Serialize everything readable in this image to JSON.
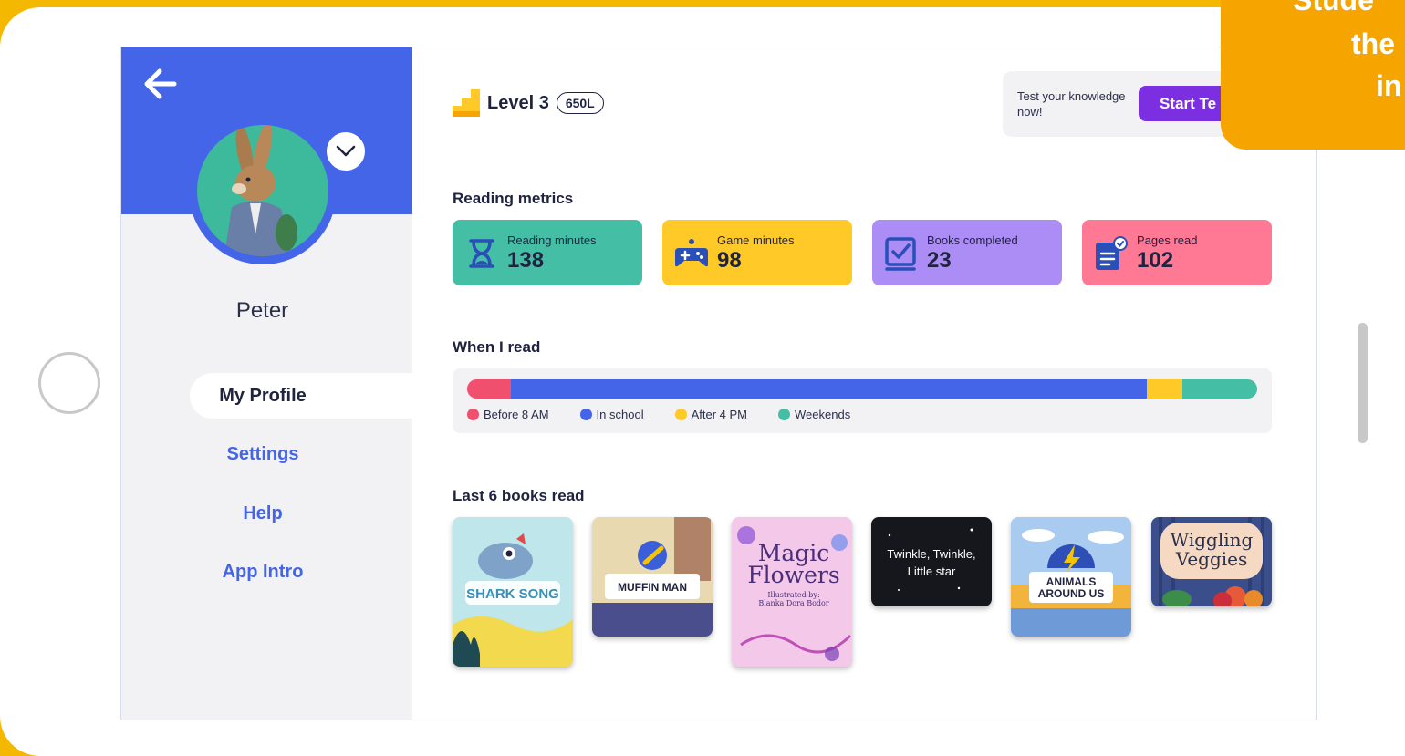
{
  "profile": {
    "name": "Peter"
  },
  "nav": [
    {
      "label": "My Profile",
      "active": true
    },
    {
      "label": "Settings",
      "active": false
    },
    {
      "label": "Help",
      "active": false
    },
    {
      "label": "App Intro",
      "active": false
    }
  ],
  "level": {
    "title": "Level 3",
    "lexile": "650L"
  },
  "test": {
    "prompt": "Test your knowledge now!",
    "button_label": "Start Te"
  },
  "overlay": {
    "line1": "Stude",
    "line2": "the",
    "line3": "in"
  },
  "metrics": {
    "section_title": "Reading metrics",
    "items": [
      {
        "label": "Reading minutes",
        "value": "138",
        "color": "#44BFA5",
        "icon": "hourglass-icon"
      },
      {
        "label": "Game minutes",
        "value": "98",
        "color": "#FFC928",
        "icon": "gamepad-icon"
      },
      {
        "label": "Books completed",
        "value": "23",
        "color": "#AC8CF5",
        "icon": "checkbox-icon"
      },
      {
        "label": "Pages read",
        "value": "102",
        "color": "#FF7894",
        "icon": "document-check-icon"
      }
    ]
  },
  "when_i_read": {
    "section_title": "When I read",
    "segments": [
      {
        "label": "Before 8 AM",
        "fraction": 0.056,
        "color": "#F0506E"
      },
      {
        "label": "In school",
        "fraction": 0.804,
        "color": "#4565E8"
      },
      {
        "label": "After 4 PM",
        "fraction": 0.045,
        "color": "#FFC928"
      },
      {
        "label": "Weekends",
        "fraction": 0.095,
        "color": "#44BFA5"
      }
    ]
  },
  "books": {
    "section_title": "Last 6 books read",
    "items": [
      {
        "title": "SHARK SONG"
      },
      {
        "title": "MUFFIN MAN"
      },
      {
        "title": "Magic Flowers",
        "byline": "Illustrated by: Blanka Dora Bodor"
      },
      {
        "title": "Twinkle, Twinkle, Little star"
      },
      {
        "title": "ANIMALS AROUND US"
      },
      {
        "title": "Wiggling Veggies"
      }
    ]
  },
  "colors": {
    "brand_blue": "#4565E8",
    "purple": "#7B2FE0",
    "frame_yellow": "#F5B800",
    "overlay_orange": "#F5A400"
  }
}
